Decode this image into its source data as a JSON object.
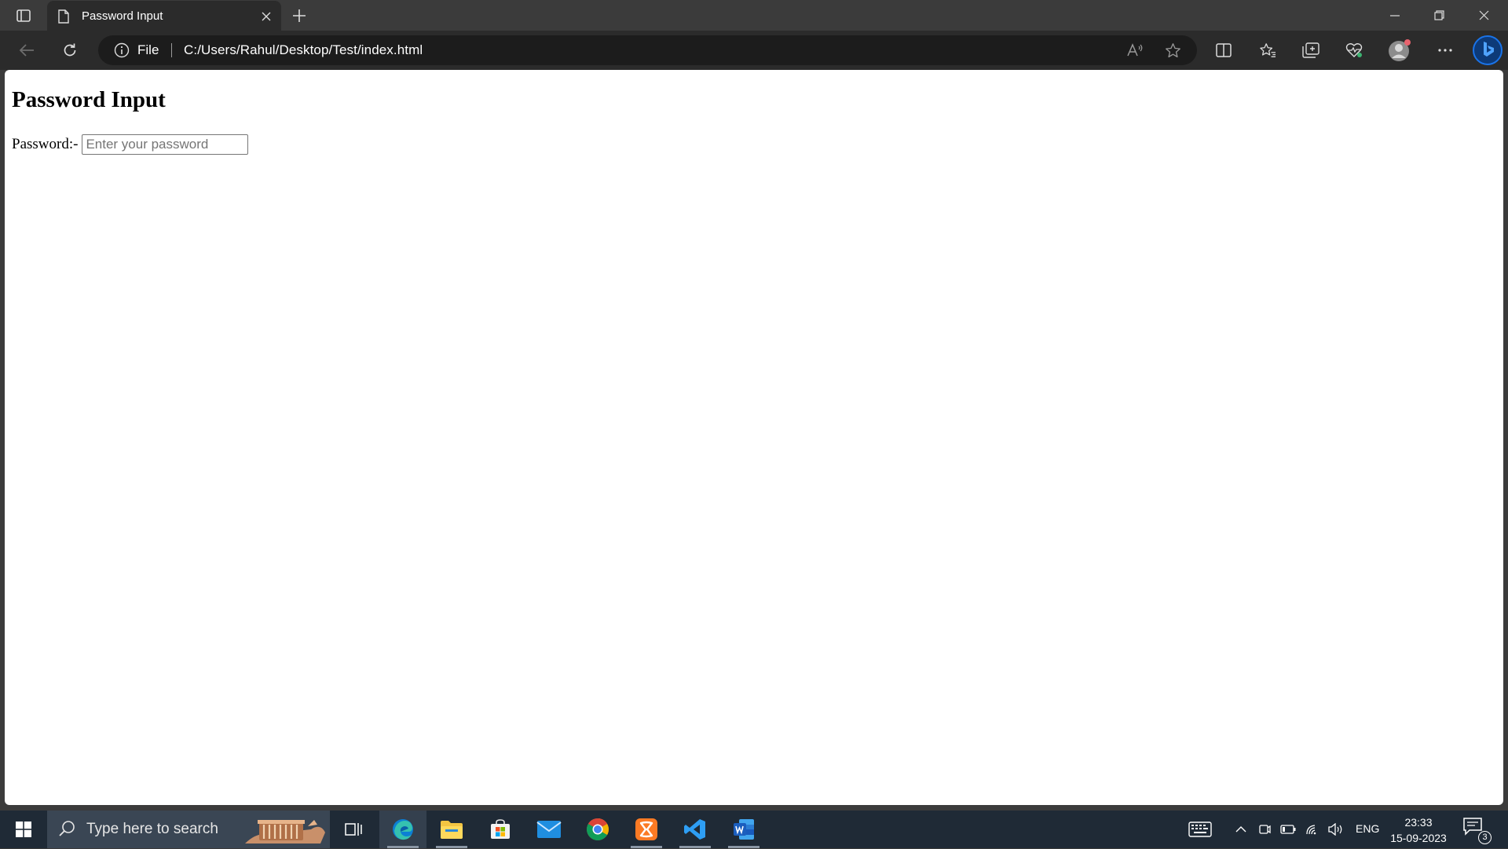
{
  "browser": {
    "tab": {
      "title": "Password Input"
    },
    "address": {
      "site_label": "File",
      "url": "C:/Users/Rahul/Desktop/Test/index.html"
    }
  },
  "page": {
    "heading": "Password Input",
    "password_label": "Password:-",
    "password_placeholder": "Enter your password",
    "password_value": ""
  },
  "taskbar": {
    "search_placeholder": "Type here to search",
    "apps": [
      "task-view",
      "edge",
      "file-explorer",
      "microsoft-store",
      "mail",
      "chrome",
      "xampp",
      "vs-code",
      "word"
    ],
    "language": "ENG",
    "time": "23:33",
    "date": "15-09-2023",
    "notification_count": "3"
  },
  "colors": {
    "titlebar": "#3b3b3b",
    "toolbar": "#2b2b2b",
    "addressbar": "#1c1c1c",
    "taskbar": "#1f2a36",
    "copilot_accent": "#1a73e8"
  }
}
